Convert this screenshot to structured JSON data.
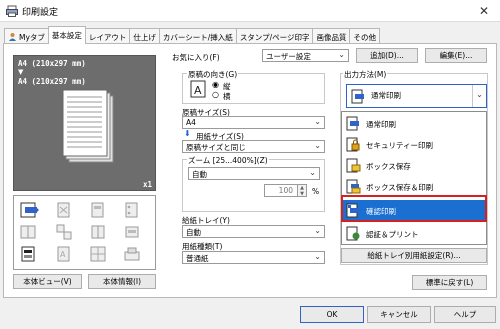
{
  "window": {
    "title": "印刷設定",
    "icon": "printer-icon",
    "close_glyph": "✕"
  },
  "tabs": [
    {
      "label": "Myタブ",
      "icon": "user-icon"
    },
    {
      "label": "基本設定"
    },
    {
      "label": "レイアウト"
    },
    {
      "label": "仕上げ"
    },
    {
      "label": "カバーシート/挿入紙"
    },
    {
      "label": "スタンプ/ページ印字"
    },
    {
      "label": "画像品質"
    },
    {
      "label": "その他"
    }
  ],
  "favorites": {
    "label": "お気に入り(F)",
    "value": "ユーザー設定",
    "add_button": "追加(D)...",
    "edit_button": "編集(E)..."
  },
  "preview": {
    "line1": "A4 (210x297 mm)",
    "line2": "A4 (210x297 mm)",
    "copies": "x1"
  },
  "left_buttons": {
    "view": "本体ビュー(V)",
    "info": "本体情報(I)"
  },
  "orientation": {
    "label": "原稿の向き(G)",
    "options": [
      "縦",
      "横"
    ],
    "selected": "縦"
  },
  "original_size": {
    "label": "原稿サイズ(S)",
    "value": "A4"
  },
  "paper_size": {
    "label": "用紙サイズ(S)",
    "value": "原稿サイズと同じ"
  },
  "zoom": {
    "label": "ズーム [25...400%](Z)",
    "value": "自動",
    "percent_value": "100",
    "percent_unit": "%"
  },
  "paper_tray": {
    "label": "給紙トレイ(Y)",
    "value": "自動"
  },
  "paper_type": {
    "label": "用紙種類(T)",
    "value": "普通紙"
  },
  "output_method": {
    "label": "出力方法(M)",
    "value": "通常印刷",
    "options": [
      "通常印刷",
      "セキュリティー印刷",
      "ボックス保存",
      "ボックス保存＆印刷",
      "確認印刷",
      "認証＆プリント"
    ],
    "selected": "確認印刷"
  },
  "tray_settings_button": "給紙トレイ別用紙設定(R)...",
  "restore_button": "標準に戻す(L)",
  "dialog_buttons": {
    "ok": "OK",
    "cancel": "キャンセル",
    "help": "ヘルプ"
  },
  "colors": {
    "selection": "#1a6fd1",
    "highlight_border": "#d42020",
    "preview_bg": "#6d6d6d"
  }
}
